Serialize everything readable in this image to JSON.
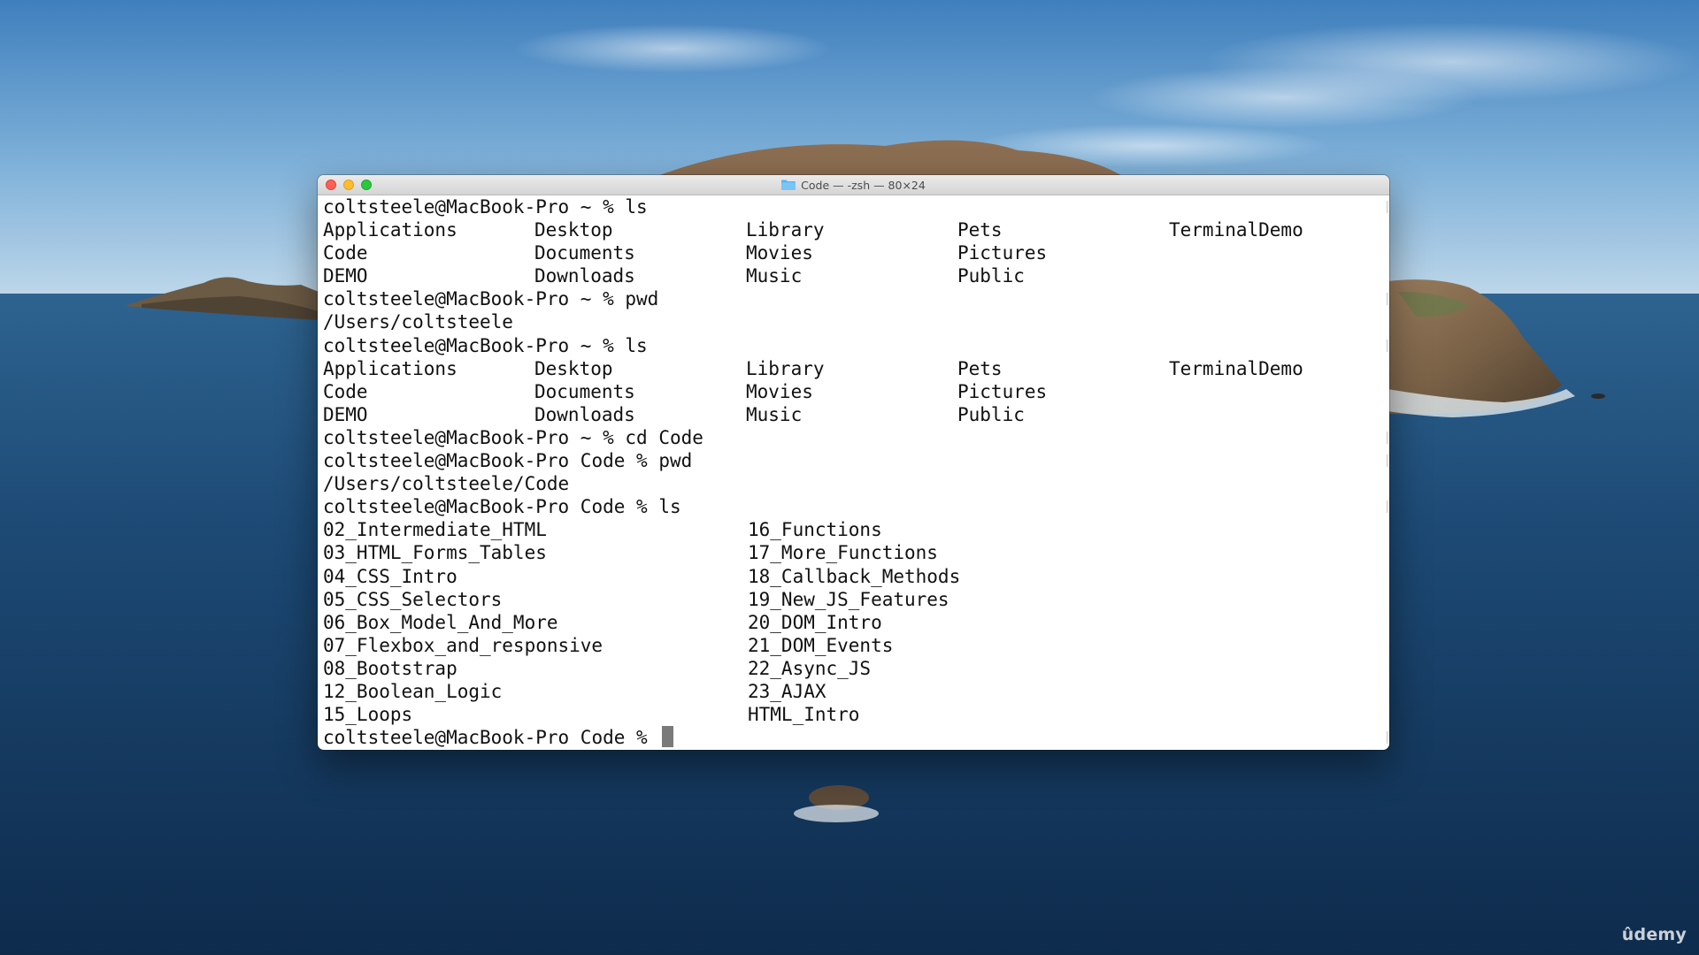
{
  "window": {
    "title": "Code — -zsh — 80×24",
    "folder_icon": "folder-icon"
  },
  "terminal": {
    "lines": [
      {
        "kind": "prompt",
        "user": "coltsteele@MacBook-Pro",
        "dir": "~",
        "symbol": "%",
        "command": "ls"
      },
      {
        "kind": "cols5",
        "cells": [
          "Applications",
          "Desktop",
          "Library",
          "Pets",
          "TerminalDemo"
        ]
      },
      {
        "kind": "cols5",
        "cells": [
          "Code",
          "Documents",
          "Movies",
          "Pictures",
          ""
        ]
      },
      {
        "kind": "cols5",
        "cells": [
          "DEMO",
          "Downloads",
          "Music",
          "Public",
          ""
        ]
      },
      {
        "kind": "prompt",
        "user": "coltsteele@MacBook-Pro",
        "dir": "~",
        "symbol": "%",
        "command": "pwd"
      },
      {
        "kind": "text",
        "text": "/Users/coltsteele"
      },
      {
        "kind": "prompt",
        "user": "coltsteele@MacBook-Pro",
        "dir": "~",
        "symbol": "%",
        "command": "ls"
      },
      {
        "kind": "cols5",
        "cells": [
          "Applications",
          "Desktop",
          "Library",
          "Pets",
          "TerminalDemo"
        ]
      },
      {
        "kind": "cols5",
        "cells": [
          "Code",
          "Documents",
          "Movies",
          "Pictures",
          ""
        ]
      },
      {
        "kind": "cols5",
        "cells": [
          "DEMO",
          "Downloads",
          "Music",
          "Public",
          ""
        ]
      },
      {
        "kind": "prompt",
        "user": "coltsteele@MacBook-Pro",
        "dir": "~",
        "symbol": "%",
        "command": "cd Code"
      },
      {
        "kind": "prompt",
        "user": "coltsteele@MacBook-Pro",
        "dir": "Code",
        "symbol": "%",
        "command": "pwd"
      },
      {
        "kind": "text",
        "text": "/Users/coltsteele/Code"
      },
      {
        "kind": "prompt",
        "user": "coltsteele@MacBook-Pro",
        "dir": "Code",
        "symbol": "%",
        "command": "ls"
      },
      {
        "kind": "cols2",
        "cells": [
          "02_Intermediate_HTML",
          "16_Functions"
        ]
      },
      {
        "kind": "cols2",
        "cells": [
          "03_HTML_Forms_Tables",
          "17_More_Functions"
        ]
      },
      {
        "kind": "cols2",
        "cells": [
          "04_CSS_Intro",
          "18_Callback_Methods"
        ]
      },
      {
        "kind": "cols2",
        "cells": [
          "05_CSS_Selectors",
          "19_New_JS_Features"
        ]
      },
      {
        "kind": "cols2",
        "cells": [
          "06_Box_Model_And_More",
          "20_DOM_Intro"
        ]
      },
      {
        "kind": "cols2",
        "cells": [
          "07_Flexbox_and_responsive",
          "21_DOM_Events"
        ]
      },
      {
        "kind": "cols2",
        "cells": [
          "08_Bootstrap",
          "22_Async_JS"
        ]
      },
      {
        "kind": "cols2",
        "cells": [
          "12_Boolean_Logic",
          "23_AJAX"
        ]
      },
      {
        "kind": "cols2",
        "cells": [
          "15_Loops",
          "HTML_Intro"
        ]
      },
      {
        "kind": "prompt",
        "user": "coltsteele@MacBook-Pro",
        "dir": "Code",
        "symbol": "%",
        "command": "",
        "cursor": true
      }
    ]
  },
  "watermark": "ûdemy",
  "colors": {
    "terminal_bg": "#ffffff",
    "terminal_text": "#111111",
    "close": "#fe5f57",
    "minimize": "#febc2e",
    "zoom": "#28c840",
    "cursor": "#7a7a7a",
    "folder": "#5ab4ef"
  }
}
